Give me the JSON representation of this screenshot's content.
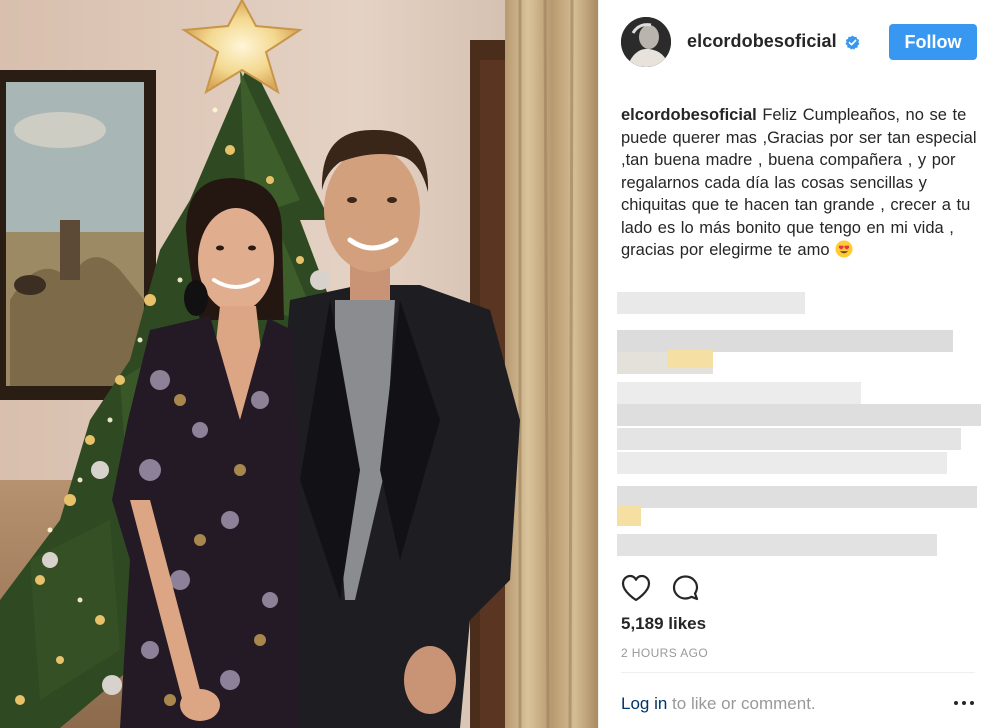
{
  "post": {
    "username": "elcordobesoficial",
    "verified": true,
    "follow_label": "Follow",
    "caption_user": "elcordobesoficial",
    "caption_text": "Feliz Cumpleaños, no se te puede querer mas ,Gracias por ser tan especial ,tan buena madre , buena compañera , y por regalarnos cada día las cosas sencillas y chiquitas que te hacen tan grande , crecer a tu lado es lo más bonito que tengo en mi vida , gracias por elegirme te amo",
    "caption_emoji": "smiling-face-with-heart-eyes-icon",
    "likes": "5,189 likes",
    "timestamp": "2 HOURS AGO",
    "footer_link": "Log in",
    "footer_text": " to like or comment."
  },
  "icons": {
    "like": "heart-outline-icon",
    "comment": "comment-bubble-icon",
    "more": "three-dots-icon",
    "verified": "verified-badge-icon"
  },
  "colors": {
    "follow_button": "#3897f0",
    "link": "#003569",
    "muted_text": "#999999",
    "verified_badge": "#3897f0"
  }
}
